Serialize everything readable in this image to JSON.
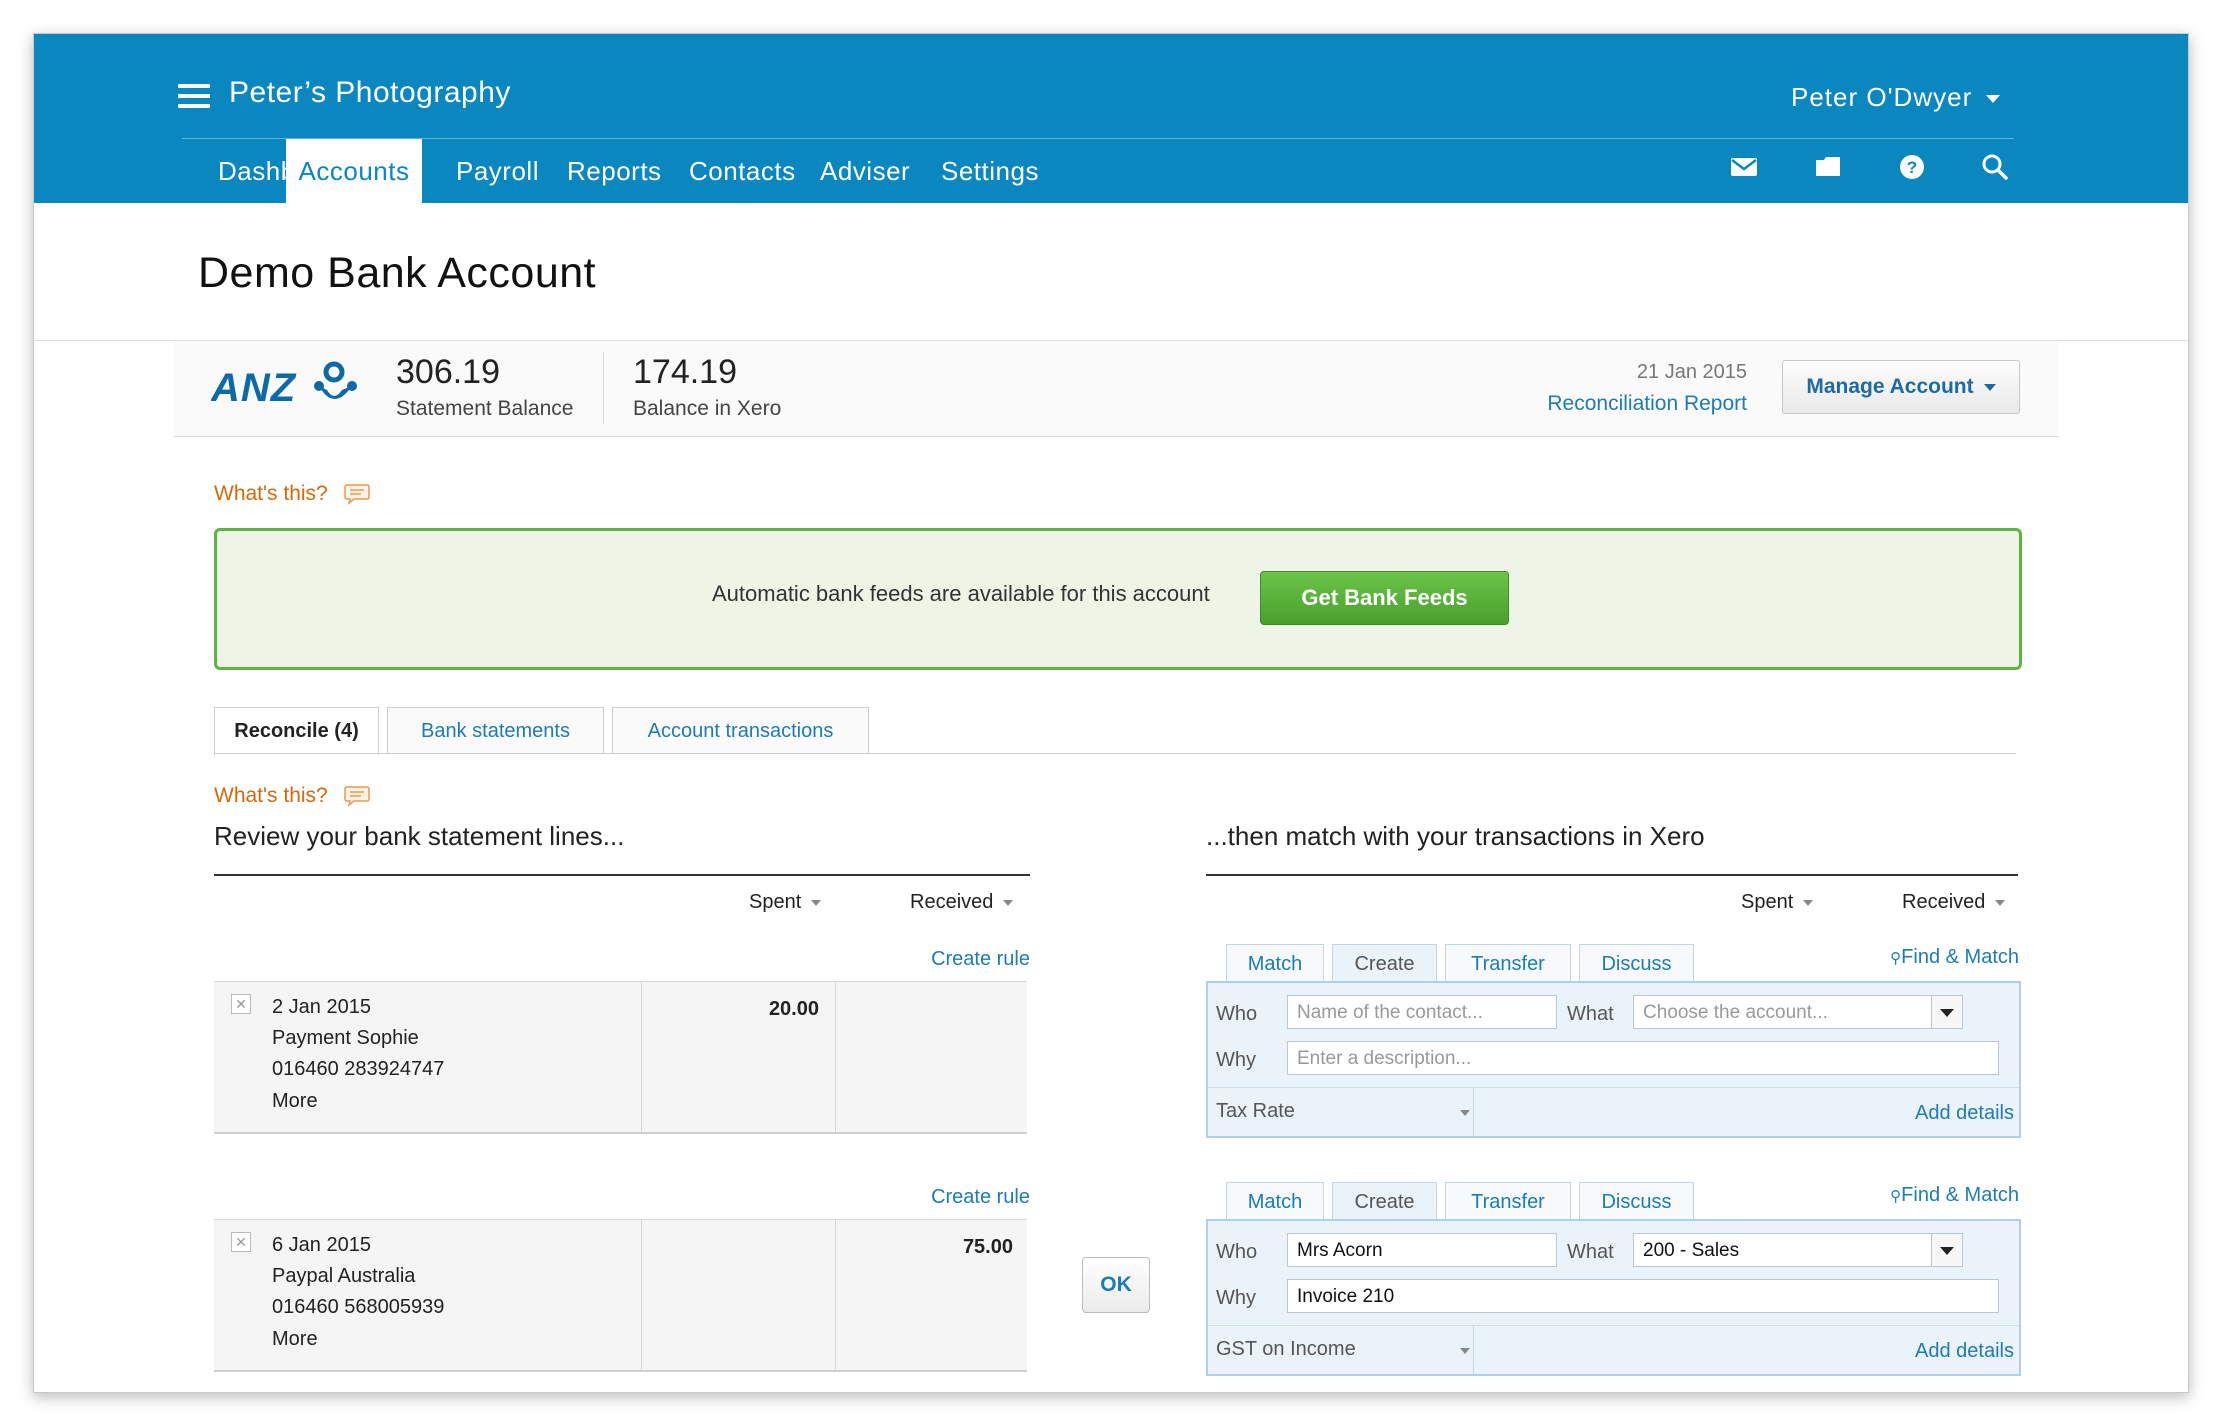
{
  "app": {
    "org_name": "Peter’s Photography",
    "user_name": "Peter O'Dwyer",
    "nav": [
      {
        "label": "Dashboard"
      },
      {
        "label": "Accounts"
      },
      {
        "label": "Payroll"
      },
      {
        "label": "Reports"
      },
      {
        "label": "Contacts"
      },
      {
        "label": "Adviser"
      },
      {
        "label": "Settings"
      }
    ],
    "active_nav": "Accounts",
    "header_icons": [
      "mail-icon",
      "folder-icon",
      "help-icon",
      "search-icon"
    ]
  },
  "page": {
    "title": "Demo Bank Account"
  },
  "account": {
    "bank_logo_text": "ANZ",
    "statement_balance": "306.19",
    "statement_balance_label": "Statement Balance",
    "xero_balance": "174.19",
    "xero_balance_label": "Balance in Xero",
    "reconciled_date": "21 Jan 2015",
    "reconciliation_report": "Reconciliation Report",
    "manage_label": "Manage Account"
  },
  "whats_this": "What's this?",
  "feeds": {
    "message": "Automatic bank feeds are available for this account",
    "button": "Get Bank Feeds"
  },
  "tabs": [
    {
      "label": "Reconcile (4)",
      "active": true
    },
    {
      "label": "Bank statements",
      "active": false
    },
    {
      "label": "Account transactions",
      "active": false
    }
  ],
  "left": {
    "heading": "Review your bank statement lines...",
    "spent": "Spent",
    "received": "Received",
    "create_rule": "Create rule",
    "lines": [
      {
        "date": "2 Jan 2015",
        "payee": "Payment Sophie",
        "ref": "016460 283924747",
        "more": "More",
        "spent": "20.00",
        "received": ""
      },
      {
        "date": "6 Jan 2015",
        "payee": "Paypal Australia",
        "ref": "016460 568005939",
        "more": "More",
        "spent": "",
        "received": "75.00"
      }
    ]
  },
  "ok_label": "OK",
  "right": {
    "heading": "...then match with your transactions in Xero",
    "spent": "Spent",
    "received": "Received",
    "match_tabs": [
      "Match",
      "Create",
      "Transfer",
      "Discuss"
    ],
    "find_match": "Find & Match",
    "who_label": "Who",
    "what_label": "What",
    "why_label": "Why",
    "add_details": "Add details",
    "panels": [
      {
        "who_placeholder": "Name of the contact...",
        "who_value": "",
        "what_placeholder": "Choose the account...",
        "what_value": "",
        "why_placeholder": "Enter a description...",
        "why_value": "",
        "tax": "Tax Rate"
      },
      {
        "who_placeholder": "",
        "who_value": "Mrs Acorn",
        "what_placeholder": "",
        "what_value": "200 - Sales",
        "why_placeholder": "",
        "why_value": "Invoice 210",
        "tax": "GST on Income"
      }
    ]
  },
  "colors": {
    "header_blue": "#0b87c0",
    "link_blue": "#1d7bb8",
    "feed_green": "#5eb440",
    "whats_orange": "#d4680b"
  }
}
